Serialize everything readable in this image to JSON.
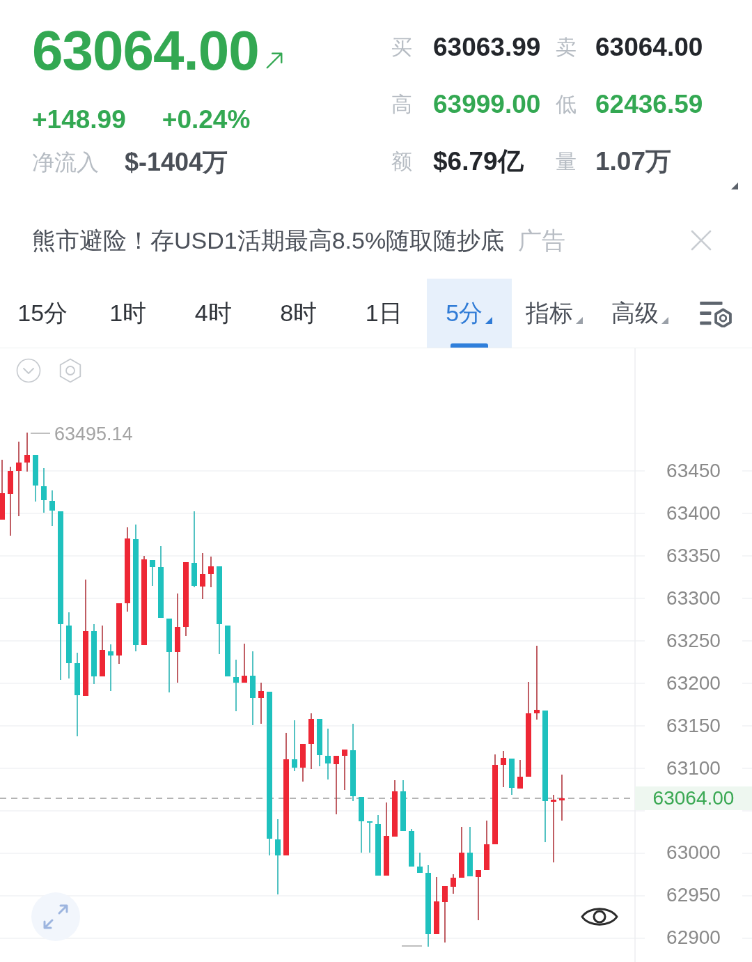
{
  "quote": {
    "price": "63064.00",
    "rising": true,
    "change": "+148.99",
    "change_percent": "+0.24%",
    "net_inflow_label": "净流入",
    "net_inflow": "$-1404万"
  },
  "stats": [
    {
      "label": "买",
      "value": "63063.99",
      "color": "#23262b"
    },
    {
      "label": "卖",
      "value": "63064.00",
      "color": "#23262b"
    },
    {
      "label": "高",
      "value": "63999.00",
      "color": "#33a852"
    },
    {
      "label": "低",
      "value": "62436.59",
      "color": "#33a852"
    },
    {
      "label": "额",
      "value": "$6.79亿",
      "color": "#23262b"
    },
    {
      "label": "量",
      "value": "1.07万",
      "color": "#4a4f57"
    }
  ],
  "ad": {
    "text": "熊市避险！存USD1活期最高8.5%随取随抄底",
    "tag": "广告"
  },
  "timeframes": [
    {
      "label": "15分",
      "selected": false,
      "dropdown": false
    },
    {
      "label": "1时",
      "selected": false,
      "dropdown": false
    },
    {
      "label": "4时",
      "selected": false,
      "dropdown": false
    },
    {
      "label": "8时",
      "selected": false,
      "dropdown": false
    },
    {
      "label": "1日",
      "selected": false,
      "dropdown": false
    },
    {
      "label": "5分",
      "selected": true,
      "dropdown": true
    }
  ],
  "menus": [
    {
      "label": "指标"
    },
    {
      "label": "高级"
    }
  ],
  "chart": {
    "high_label": "63495.14",
    "axis_upper": [
      "63450",
      "63400",
      "63350",
      "63300",
      "63250",
      "63200",
      "63150",
      "63100"
    ],
    "axis_lower": [
      "63000",
      "62950",
      "62900"
    ],
    "current_price": "63064.00"
  }
}
